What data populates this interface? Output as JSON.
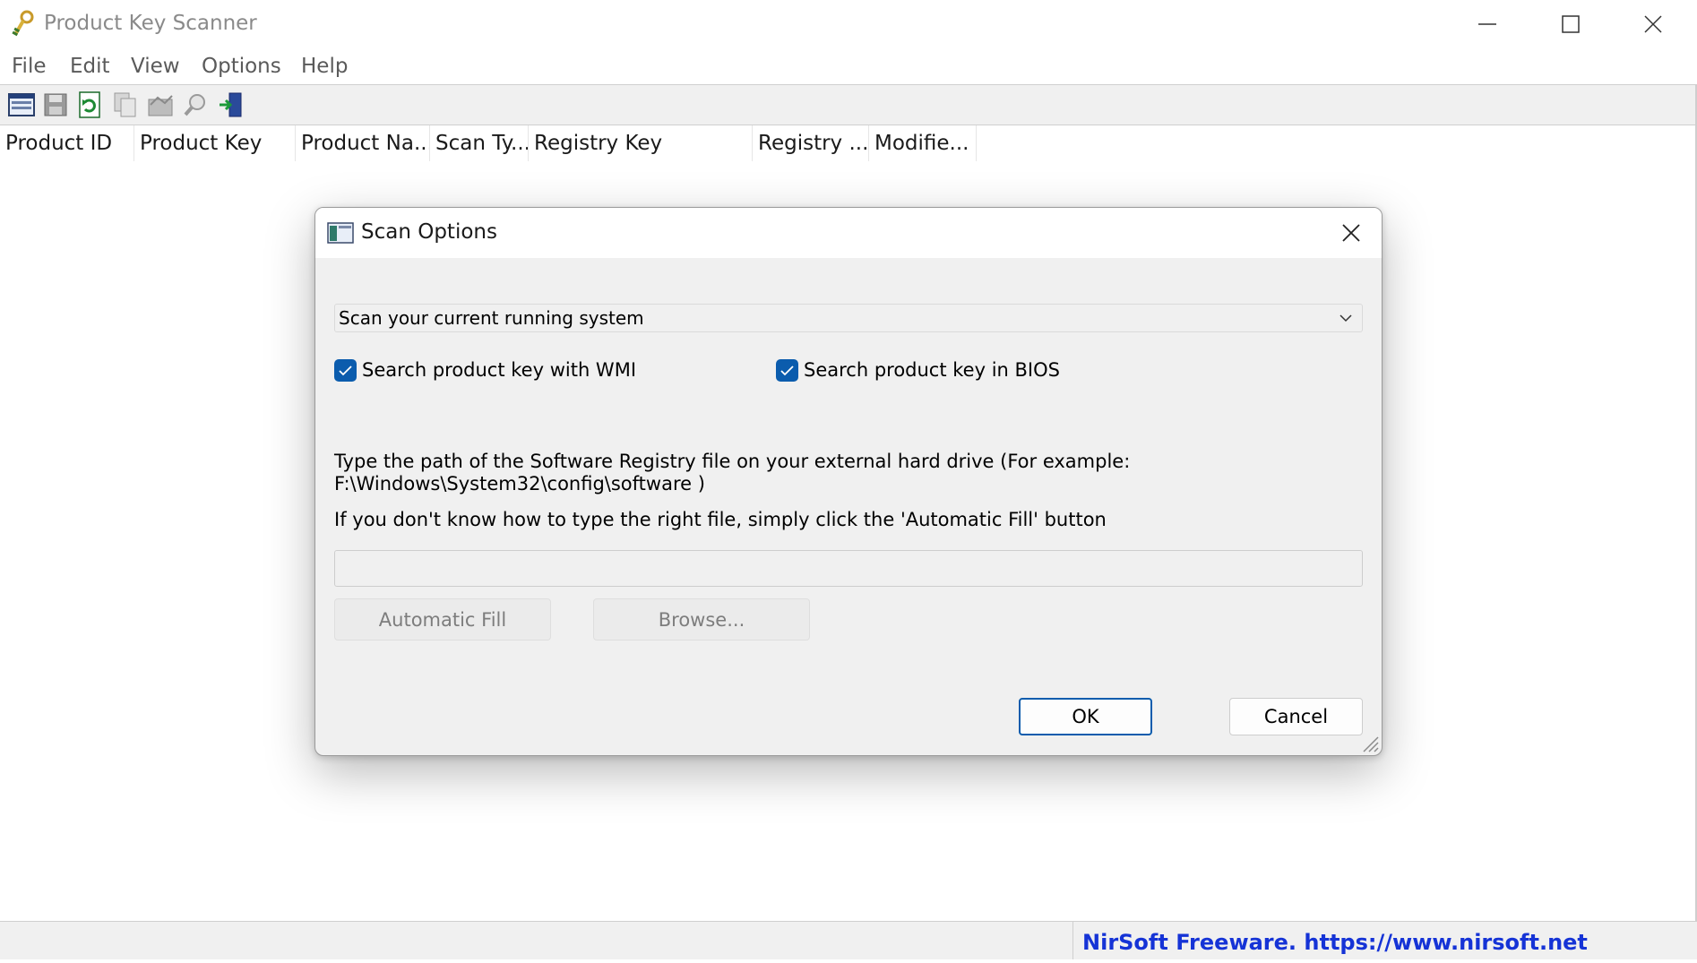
{
  "window": {
    "title": "Product Key Scanner",
    "icon": "key-app-icon",
    "controls": [
      "minimize-icon",
      "maximize-icon",
      "close-icon"
    ]
  },
  "menu": [
    "File",
    "Edit",
    "View",
    "Options",
    "Help"
  ],
  "toolbar": {
    "buttons": [
      "scan-options-icon",
      "save-icon",
      "refresh-icon",
      "copy-icon",
      "html-report-icon",
      "find-icon",
      "exit-icon"
    ]
  },
  "columns": [
    "Product ID",
    "Product Key",
    "Product Na...",
    "Scan Ty...",
    "Registry Key",
    "Registry ...",
    "Modifie..."
  ],
  "status": {
    "link_text": "NirSoft Freeware. https://www.nirsoft.net",
    "link_color": "#1533d6"
  },
  "dialog": {
    "title": "Scan Options",
    "scan_mode": "Scan your current running system",
    "wmi_label": "Search product key with WMI",
    "wmi_checked": true,
    "bios_label": "Search product key in BIOS",
    "bios_checked": true,
    "instructions_line1": "Type the path of the Software Registry file on your external hard drive (For example:",
    "instructions_line2": "F:\\Windows\\System32\\config\\software )",
    "hint": "If you don't know how to type the right file, simply click the 'Automatic Fill' button",
    "path_value": "",
    "auto_fill_label": "Automatic Fill",
    "browse_label": "Browse...",
    "ok_label": "OK",
    "cancel_label": "Cancel",
    "accent_color": "#0b5cad"
  }
}
